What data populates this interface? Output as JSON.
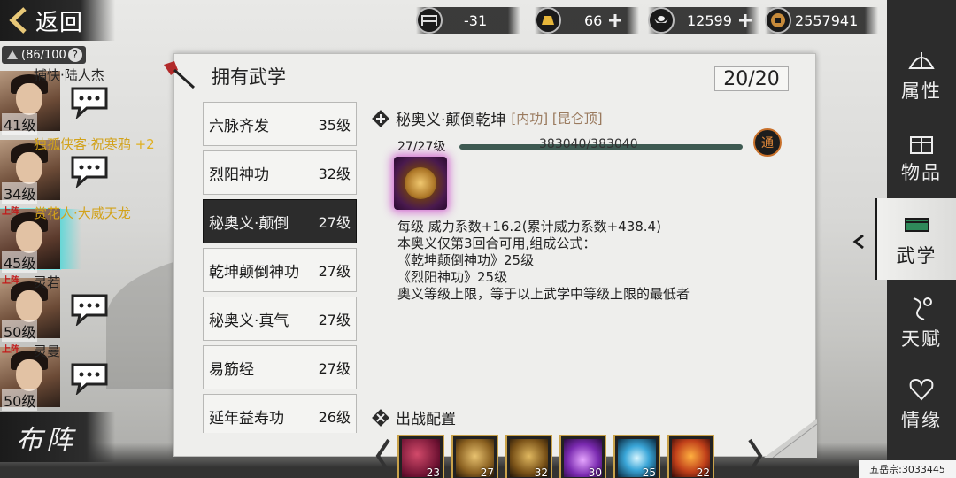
{
  "nav": {
    "back_label": "返回"
  },
  "roster": {
    "capacity": "(86/100",
    "help": "?"
  },
  "currency": [
    {
      "icon": "bed-icon",
      "value": "-31",
      "plus": false
    },
    {
      "icon": "gold-bar-icon",
      "value": "66",
      "plus": true
    },
    {
      "icon": "silver-ingot-icon",
      "value": "12599",
      "plus": true
    },
    {
      "icon": "copper-coin-icon",
      "value": "2557941",
      "plus": false
    }
  ],
  "heroes": [
    {
      "name": "捕快·陆人杰",
      "level": "41级",
      "onfield": "",
      "extra": ""
    },
    {
      "name": "独孤侠客·祝寒鸦",
      "level": "34级",
      "onfield": "",
      "extra": "+2"
    },
    {
      "name": "赏花人·大威天龙",
      "level": "45级",
      "onfield": "上阵",
      "extra": ""
    },
    {
      "name": "灵若",
      "level": "50级",
      "onfield": "上阵",
      "extra": ""
    },
    {
      "name": "灵曼",
      "level": "50级",
      "onfield": "上阵",
      "extra": ""
    }
  ],
  "formation_label": "布阵",
  "panel": {
    "title": "拥有武学",
    "count": "20/20",
    "skills": [
      {
        "name": "六脉齐发",
        "level": "35级"
      },
      {
        "name": "烈阳神功",
        "level": "32级"
      },
      {
        "name": "秘奥义·颠倒",
        "level": "27级"
      },
      {
        "name": "乾坤颠倒神功",
        "level": "27级"
      },
      {
        "name": "秘奥义·真气",
        "level": "27级"
      },
      {
        "name": "易筋经",
        "level": "27级"
      },
      {
        "name": "延年益寿功",
        "level": "26级"
      }
    ]
  },
  "detail": {
    "name": "秘奥义·颠倒乾坤",
    "tags": "[内功] [昆仑顶]",
    "level": "27/27级",
    "exp": "383040/383040",
    "exp_progress": 1.0,
    "tong_label": "通",
    "desc": [
      "每级   威力系数+16.2(累计威力系数+438.4)",
      "本奥义仅第3回合可用,组成公式：",
      "《乾坤颠倒神功》25级",
      "《烈阳神功》25级",
      "奥义等级上限，等于以上武学中等级上限的最低者"
    ]
  },
  "battle": {
    "title": "出战配置",
    "slots": [
      "23",
      "27",
      "32",
      "30",
      "25",
      "22"
    ]
  },
  "right_tabs": [
    {
      "label": "属性",
      "icon": "fan-icon"
    },
    {
      "label": "物品",
      "icon": "gift-box-icon"
    },
    {
      "label": "武学",
      "icon": "book-icon",
      "active": true
    },
    {
      "label": "天赋",
      "icon": "talent-icon"
    },
    {
      "label": "情缘",
      "icon": "heart-icon"
    }
  ],
  "footer": "五岳宗:3033445"
}
